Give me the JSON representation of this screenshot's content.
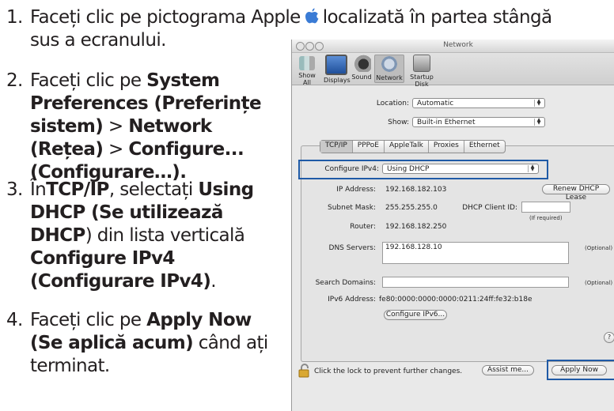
{
  "steps": [
    {
      "num": "1.",
      "line1": "Faceți clic pe pictograma Apple",
      "line1b": "localizată în partea stângă",
      "line2": "sus a ecranului."
    },
    {
      "num": "2.",
      "l1_plain": "Faceți clic pe ",
      "l1_bold": "System",
      "l2_bold": "Preferences (Preferințe",
      "l3_bold": "sistem)",
      "l3_plain": " > ",
      "l3_bold2": "Network",
      "l4_bold": "(Rețea)",
      "l4_plain": " > ",
      "l4_bold2": "Configure...",
      "l5_bold": "(Configurare…)."
    },
    {
      "num": "3.",
      "l1_plain": "În",
      "l1_bold": "TCP/IP",
      "l1_plain2": ", selectați ",
      "l1_bold2": "Using",
      "l2_bold": "DHCP (Se utilizează",
      "l3_bold": "DHCP",
      "l3_plain": ") din lista verticală",
      "l4_bold": "Configure IPv4",
      "l5_bold": "(Configurare IPv4)",
      "l5_plain": "."
    },
    {
      "num": "4.",
      "l1_plain": "Faceți clic pe ",
      "l1_bold": "Apply Now",
      "l2_bold": "(Se aplică acum)",
      "l2_plain": " când ați",
      "l3_plain": "terminat."
    }
  ],
  "window": {
    "title": "Network",
    "toolbar": [
      "Show All",
      "Displays",
      "Sound",
      "Network",
      "Startup Disk"
    ],
    "location_label": "Location:",
    "location_value": "Automatic",
    "show_label": "Show:",
    "show_value": "Built-in Ethernet",
    "tabs": [
      "TCP/IP",
      "PPPoE",
      "AppleTalk",
      "Proxies",
      "Ethernet"
    ],
    "configure_label": "Configure IPv4:",
    "configure_value": "Using DHCP",
    "ip_label": "IP Address:",
    "ip_value": "192.168.182.103",
    "renew_button": "Renew DHCP Lease",
    "subnet_label": "Subnet Mask:",
    "subnet_value": "255.255.255.0",
    "client_id_label": "DHCP Client ID:",
    "client_id_value": "",
    "if_required": "(If required)",
    "router_label": "Router:",
    "router_value": "192.168.182.250",
    "dns_label": "DNS Servers:",
    "dns_value": "192.168.128.10",
    "optional1": "(Optional)",
    "search_label": "Search Domains:",
    "search_value": "",
    "optional2": "(Optional)",
    "ipv6_label": "IPv6 Address:",
    "ipv6_value": "fe80:0000:0000:0000:0211:24ff:fe32:b18e",
    "configure_ipv6_button": "Configure IPv6...",
    "help": "?",
    "lock_text": "Click the lock to prevent further changes.",
    "assist_button": "Assist me...",
    "apply_button": "Apply Now"
  }
}
